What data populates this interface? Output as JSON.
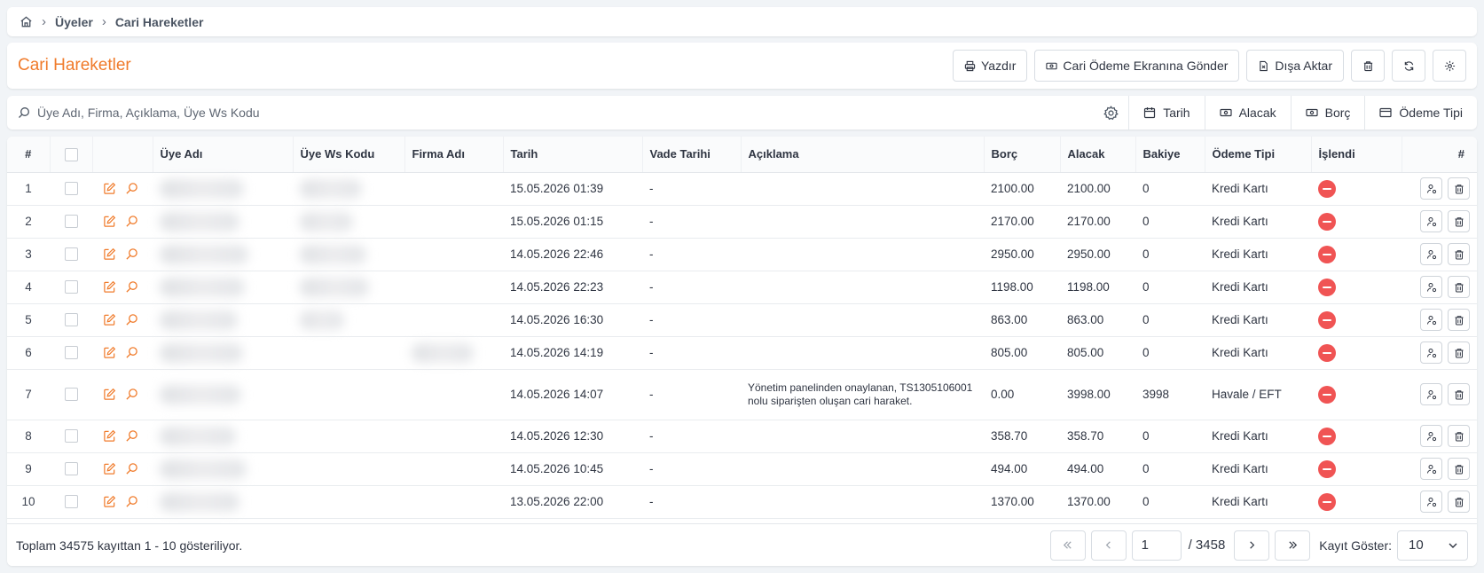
{
  "breadcrumb": {
    "items": [
      "Üyeler",
      "Cari Hareketler"
    ]
  },
  "header": {
    "title": "Cari Hareketler",
    "buttons": {
      "print": "Yazdır",
      "send_payment": "Cari Ödeme Ekranına Gönder",
      "export": "Dışa Aktar"
    }
  },
  "filters": {
    "search_placeholder": "Üye Adı, Firma, Açıklama, Üye Ws Kodu",
    "date": "Tarih",
    "credit": "Alacak",
    "debit": "Borç",
    "payment_type": "Ödeme Tipi"
  },
  "table": {
    "columns": [
      "#",
      "Üye Adı",
      "Üye Ws Kodu",
      "Firma Adı",
      "Tarih",
      "Vade Tarihi",
      "Açıklama",
      "Borç",
      "Alacak",
      "Bakiye",
      "Ödeme Tipi",
      "İşlendi",
      "#"
    ],
    "rows": [
      {
        "no": "1",
        "date": "15.05.2026 01:39",
        "due": "-",
        "desc": "",
        "debit": "2100.00",
        "credit": "2100.00",
        "balance": "0",
        "ptype": "Kredi Kartı"
      },
      {
        "no": "2",
        "date": "15.05.2026 01:15",
        "due": "-",
        "desc": "",
        "debit": "2170.00",
        "credit": "2170.00",
        "balance": "0",
        "ptype": "Kredi Kartı"
      },
      {
        "no": "3",
        "date": "14.05.2026 22:46",
        "due": "-",
        "desc": "",
        "debit": "2950.00",
        "credit": "2950.00",
        "balance": "0",
        "ptype": "Kredi Kartı"
      },
      {
        "no": "4",
        "date": "14.05.2026 22:23",
        "due": "-",
        "desc": "",
        "debit": "1198.00",
        "credit": "1198.00",
        "balance": "0",
        "ptype": "Kredi Kartı"
      },
      {
        "no": "5",
        "date": "14.05.2026 16:30",
        "due": "-",
        "desc": "",
        "debit": "863.00",
        "credit": "863.00",
        "balance": "0",
        "ptype": "Kredi Kartı"
      },
      {
        "no": "6",
        "date": "14.05.2026 14:19",
        "due": "-",
        "desc": "",
        "debit": "805.00",
        "credit": "805.00",
        "balance": "0",
        "ptype": "Kredi Kartı"
      },
      {
        "no": "7",
        "date": "14.05.2026 14:07",
        "due": "-",
        "desc": "Yönetim panelinden onaylanan, TS1305106001 nolu siparişten oluşan cari haraket.",
        "debit": "0.00",
        "credit": "3998.00",
        "balance": "3998",
        "ptype": "Havale / EFT"
      },
      {
        "no": "8",
        "date": "14.05.2026 12:30",
        "due": "-",
        "desc": "",
        "debit": "358.70",
        "credit": "358.70",
        "balance": "0",
        "ptype": "Kredi Kartı"
      },
      {
        "no": "9",
        "date": "14.05.2026 10:45",
        "due": "-",
        "desc": "",
        "debit": "494.00",
        "credit": "494.00",
        "balance": "0",
        "ptype": "Kredi Kartı"
      },
      {
        "no": "10",
        "date": "13.05.2026 22:00",
        "due": "-",
        "desc": "",
        "debit": "1370.00",
        "credit": "1370.00",
        "balance": "0",
        "ptype": "Kredi Kartı"
      }
    ]
  },
  "footer": {
    "summary": "Toplam 34575 kayıttan 1 - 10 gösteriliyor.",
    "current_page": "1",
    "total_pages": "/ 3458",
    "page_size_label": "Kayıt Göster:",
    "page_size": "10"
  },
  "colors": {
    "accent": "#f07b2b",
    "status_no": "#f05454"
  }
}
